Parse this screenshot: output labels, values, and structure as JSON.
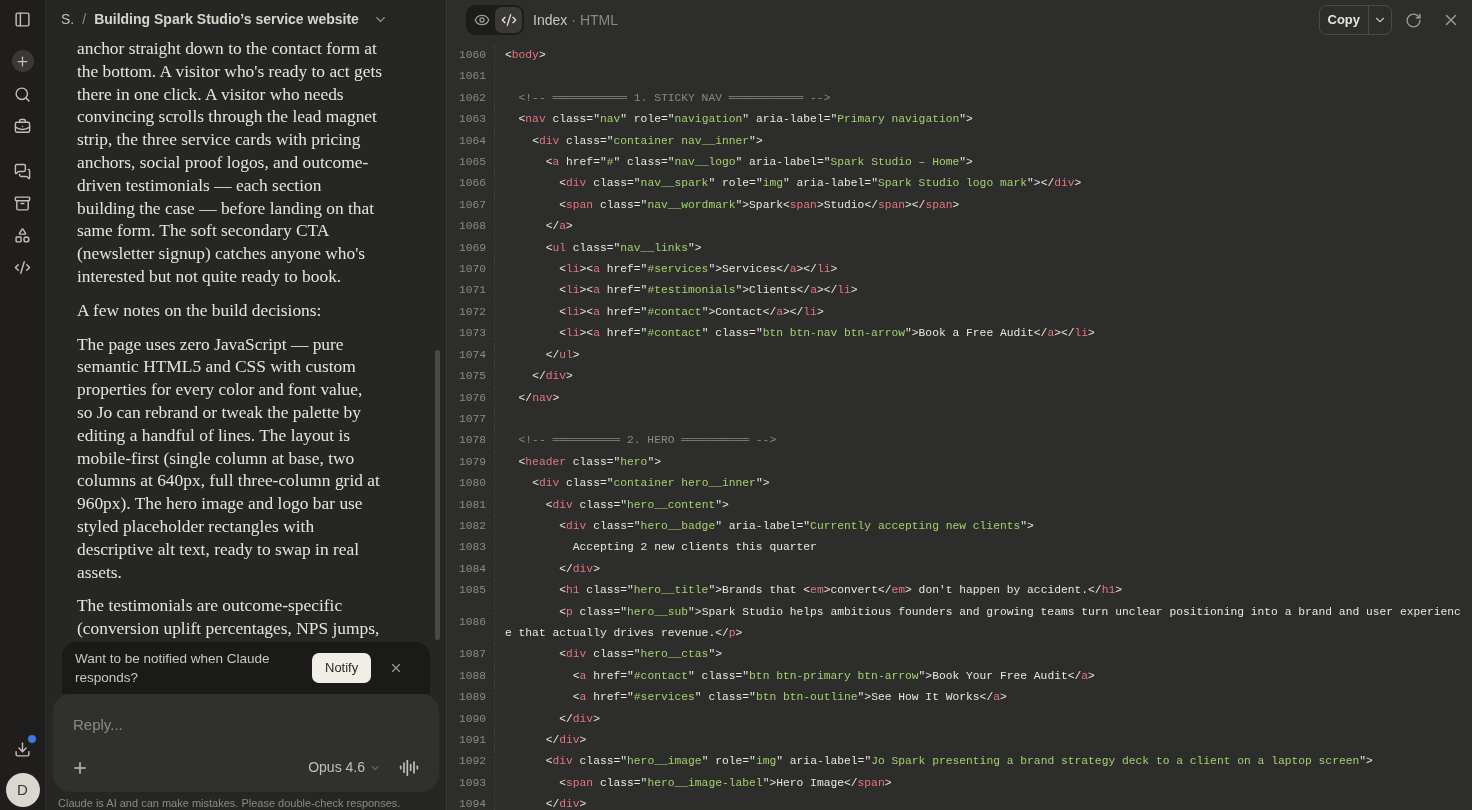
{
  "sidebar": {
    "downloads_unread": true,
    "avatar_initial": "D"
  },
  "conversation": {
    "breadcrumb": {
      "project": "S.",
      "separator": "/",
      "title": "Building Spark Studio’s service website"
    },
    "paragraphs": [
      "anchor straight down to the contact form at the bottom. A visitor who's ready to act gets there in one click. A visitor who needs convincing scrolls through the lead magnet strip, the three service cards with pricing anchors, social proof logos, and outcome-driven testimonials — each section building the case — before landing on that same form. The soft secondary CTA (newsletter signup) catches anyone who's interested but not quite ready to book.",
      "A few notes on the build decisions:",
      "The page uses zero JavaScript — pure semantic HTML5 and CSS with custom properties for every color and font value, so Jo can rebrand or tweak the palette by editing a handful of lines. The layout is mobile-first (single column at base, two columns at 640px, full three-column grid at 960px). The hero image and logo bar use styled placeholder rectangles with descriptive alt text, ready to swap in real assets.",
      "The testimonials are outcome-specific (conversion uplift percentages, NPS jumps,"
    ],
    "notification": {
      "text": "Want to be notified when Claude responds?",
      "button": "Notify"
    },
    "composer": {
      "placeholder": "Reply...",
      "model": "Opus 4.6"
    },
    "disclaimer": "Claude is AI and can make mistakes. Please double-check responses."
  },
  "artifact": {
    "view_modes": [
      {
        "kind": "preview",
        "selected": false
      },
      {
        "kind": "code",
        "selected": true
      }
    ],
    "title": "Index",
    "separator": "·",
    "file_type": "HTML",
    "copy_label": "Copy",
    "code_lines": [
      {
        "number": "1060",
        "text": "<body>"
      },
      {
        "number": "1061"
      },
      {
        "number": "1062",
        "text": "  <!-- ═══════════ 1. STICKY NAV ═══════════ -->"
      },
      {
        "number": "1063",
        "text": "  <nav class=\"nav\" role=\"navigation\" aria-label=\"Primary navigation\">"
      },
      {
        "number": "1064",
        "text": "    <div class=\"container nav__inner\">"
      },
      {
        "number": "1065",
        "text": "      <a href=\"#\" class=\"nav__logo\" aria-label=\"Spark Studio – Home\">"
      },
      {
        "number": "1066",
        "text": "        <div class=\"nav__spark\" role=\"img\" aria-label=\"Spark Studio logo mark\"></div>"
      },
      {
        "number": "1067",
        "text": "        <span class=\"nav__wordmark\">Spark<span>Studio</span></span>"
      },
      {
        "number": "1068",
        "text": "      </a>"
      },
      {
        "number": "1069",
        "text": "      <ul class=\"nav__links\">"
      },
      {
        "number": "1070",
        "text": "        <li><a href=\"#services\">Services</a></li>"
      },
      {
        "number": "1071",
        "text": "        <li><a href=\"#testimonials\">Clients</a></li>"
      },
      {
        "number": "1072",
        "text": "        <li><a href=\"#contact\">Contact</a></li>"
      },
      {
        "number": "1073",
        "text": "        <li><a href=\"#contact\" class=\"btn btn-nav btn-arrow\">Book a Free Audit</a></li>"
      },
      {
        "number": "1074",
        "text": "      </ul>"
      },
      {
        "number": "1075",
        "text": "    </div>"
      },
      {
        "number": "1076",
        "text": "  </nav>"
      },
      {
        "number": "1077"
      },
      {
        "number": "1078",
        "text": "  <!-- ══════════ 2. HERO ══════════ -->"
      },
      {
        "number": "1079",
        "text": "  <header class=\"hero\">"
      },
      {
        "number": "1080",
        "text": "    <div class=\"container hero__inner\">"
      },
      {
        "number": "1081",
        "text": "      <div class=\"hero__content\">"
      },
      {
        "number": "1082",
        "text": "        <div class=\"hero__badge\" aria-label=\"Currently accepting new clients\">"
      },
      {
        "number": "1083",
        "text": "          Accepting 2 new clients this quarter"
      },
      {
        "number": "1084",
        "text": "        </div>"
      },
      {
        "number": "1085",
        "text": "        <h1 class=\"hero__title\">Brands that <em>convert</em> don't happen by accident.</h1>"
      },
      {
        "number": "1086",
        "text": "        <p class=\"hero__sub\">Spark Studio helps ambitious founders and growing teams turn unclear positioning into a brand and user experience that actually drives revenue.</p>"
      },
      {
        "number": "1087",
        "text": "        <div class=\"hero__ctas\">"
      },
      {
        "number": "1088",
        "text": "          <a href=\"#contact\" class=\"btn btn-primary btn-arrow\">Book Your Free Audit</a>"
      },
      {
        "number": "1089",
        "text": "          <a href=\"#services\" class=\"btn btn-outline\">See How It Works</a>"
      },
      {
        "number": "1090",
        "text": "        </div>"
      },
      {
        "number": "1091",
        "text": "      </div>"
      },
      {
        "number": "1092",
        "text": "      <div class=\"hero__image\" role=\"img\" aria-label=\"Jo Spark presenting a brand strategy deck to a client on a laptop screen\">"
      },
      {
        "number": "1093",
        "text": "        <span class=\"hero__image-label\">Hero Image</span>"
      },
      {
        "number": "1094",
        "text": "      </div>"
      }
    ]
  }
}
